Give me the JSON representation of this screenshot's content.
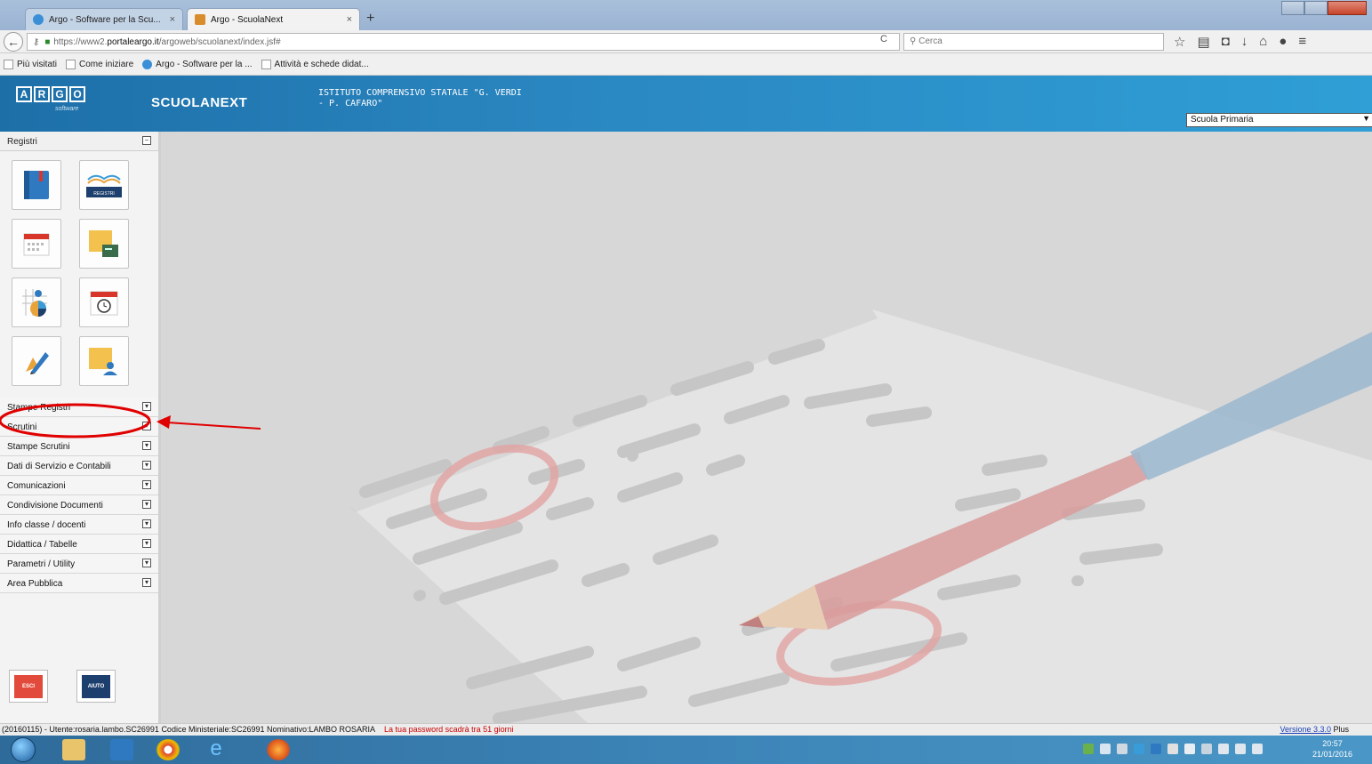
{
  "browser": {
    "tabs": [
      {
        "title": "Argo - Software per la Scu...",
        "close": "×",
        "active": false
      },
      {
        "title": "Argo - ScuolaNext",
        "close": "×",
        "active": true
      }
    ],
    "new_tab": "+",
    "url_prefix": "https://www2.",
    "url_host": "portaleargo.it",
    "url_path": "/argoweb/scuolanext/index.jsf#",
    "search_placeholder": "Cerca",
    "bookmarks": [
      "Più visitati",
      "Come iniziare",
      "Argo - Software per la ...",
      "Attività e schede didat..."
    ]
  },
  "app": {
    "logo_letters": [
      "A",
      "R",
      "G",
      "O"
    ],
    "logo_sub": "software",
    "name": "SCUOLANEXT",
    "school_line1": "ISTITUTO COMPRENSIVO STATALE \"G. VERDI",
    "school_line2": "- P. CAFARO\"",
    "school_select": "Scuola Primaria"
  },
  "sidebar": {
    "section_title": "Registri",
    "section_toggle": "−",
    "tiles": [
      {
        "icon": "register-book-icon"
      },
      {
        "icon": "registri-icon"
      },
      {
        "icon": "calendar-icon"
      },
      {
        "icon": "sticky-note-icon"
      },
      {
        "icon": "student-stats-icon"
      },
      {
        "icon": "timer-calendar-icon"
      },
      {
        "icon": "pencil-edit-icon"
      },
      {
        "icon": "user-note-icon"
      }
    ],
    "registri_tile_label": "REGISTRI",
    "menu": [
      {
        "label": "Stampe Registri",
        "toggle": "▾"
      },
      {
        "label": "Scrutini",
        "toggle": "▾"
      },
      {
        "label": "Stampe Scrutini",
        "toggle": "▾"
      },
      {
        "label": "Dati di Servizio e Contabili",
        "toggle": "▾"
      },
      {
        "label": "Comunicazioni",
        "toggle": "▾"
      },
      {
        "label": "Condivisione Documenti",
        "toggle": "▾"
      },
      {
        "label": "Info classe / docenti",
        "toggle": "▾"
      },
      {
        "label": "Didattica / Tabelle",
        "toggle": "▾"
      },
      {
        "label": "Parametri / Utility",
        "toggle": "▾"
      },
      {
        "label": "Area Pubblica",
        "toggle": "▾"
      }
    ],
    "exit_label": "ESCI",
    "help_label": "AIUTO"
  },
  "status": {
    "info": "(20160115) - Utente:rosaria.lambo.SC26991 Codice Ministeriale:SC26991 Nominativo:LAMBO ROSARIA",
    "warning": "La tua password scadrà tra 51 giorni",
    "version_link": "Versione 3.3.0",
    "version_suffix": " Plus"
  },
  "taskbar": {
    "time": "20:57",
    "date": "21/01/2016"
  },
  "colors": {
    "header_blue": "#2a86c0",
    "annotation_red": "#e00000",
    "warning_red": "#cc0000"
  }
}
